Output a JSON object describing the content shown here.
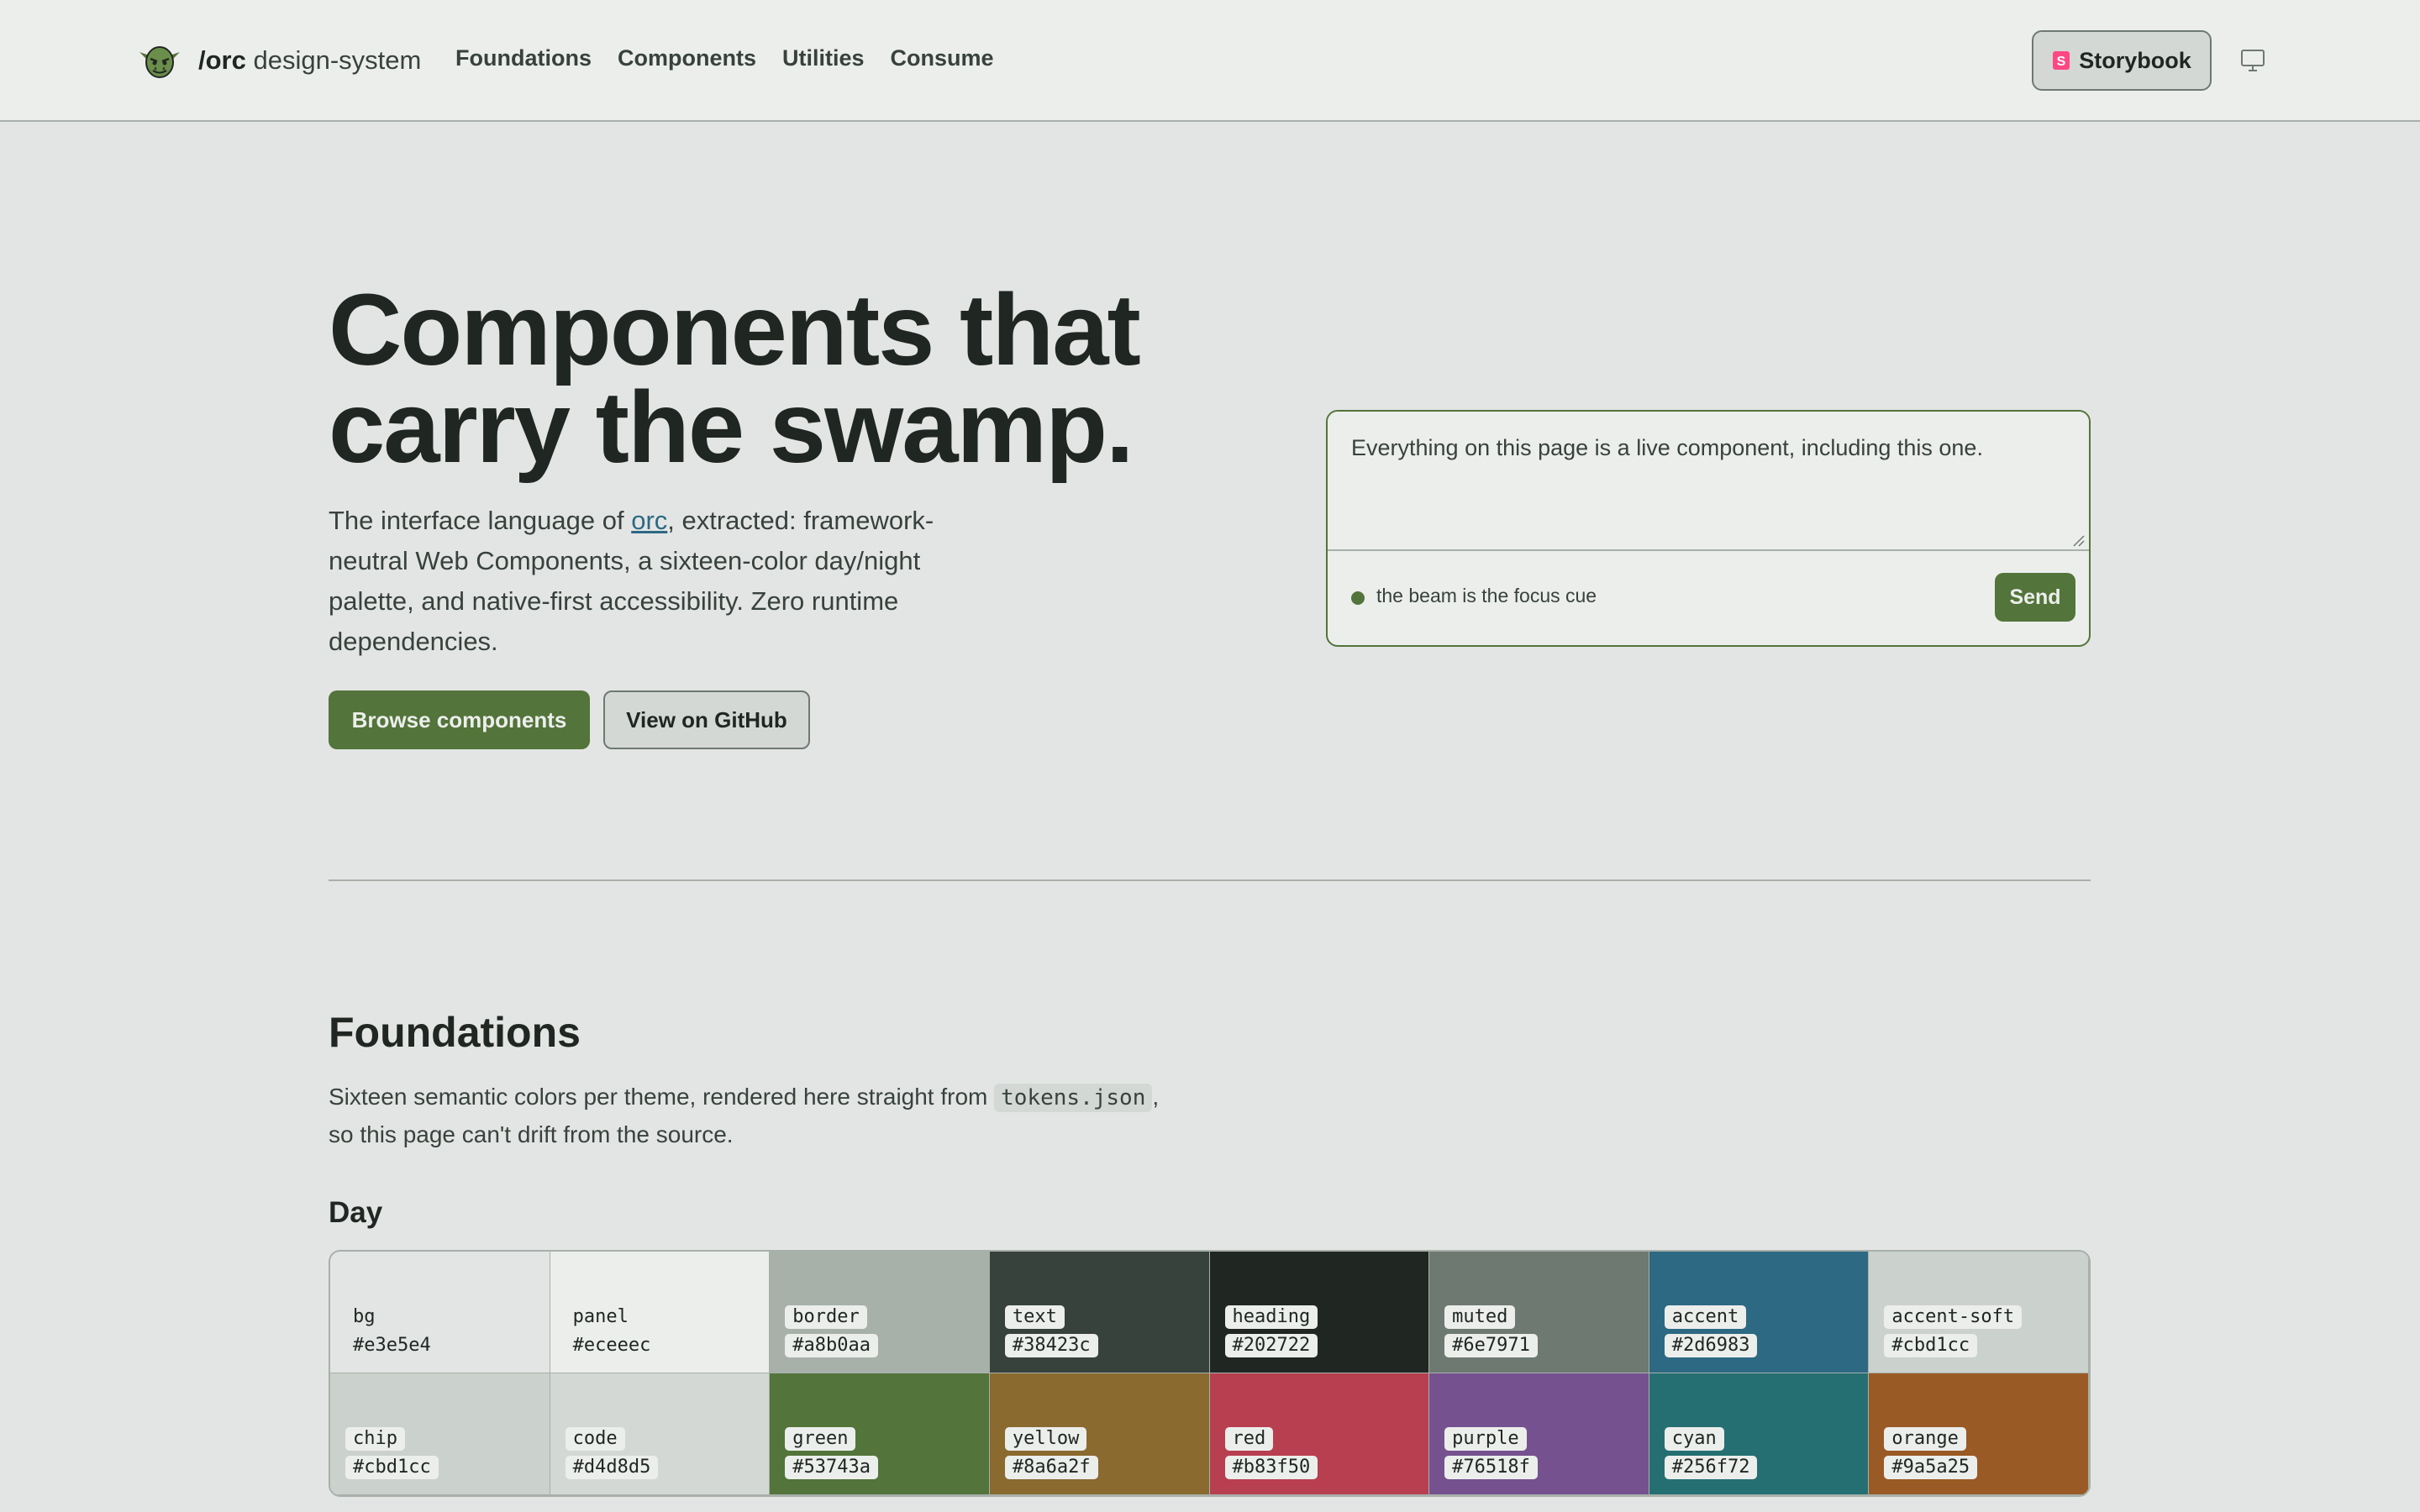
{
  "header": {
    "brand_prefix": "/orc",
    "brand_suffix": " design-system",
    "nav": [
      "Foundations",
      "Components",
      "Utilities",
      "Consume"
    ],
    "storybook_label": "Storybook",
    "storybook_icon": "storybook-icon",
    "theme_icon": "monitor-icon"
  },
  "hero": {
    "title_line1": "Components that",
    "title_line2": "carry the swamp.",
    "lede_before": "The interface language of ",
    "lede_link": "orc",
    "lede_after": ", extracted: framework-neutral Web Components, a sixteen-color day/night palette, and native-first accessibility. Zero runtime dependencies.",
    "primary_button": "Browse components",
    "secondary_button": "View on GitHub"
  },
  "composer": {
    "text": "Everything on this page is a live component, including this one.",
    "status": "the beam is the focus cue",
    "send_label": "Send"
  },
  "foundations": {
    "title": "Foundations",
    "lede_before": "Sixteen semantic colors per theme, rendered here straight from ",
    "lede_code": "tokens.json",
    "lede_after": ",",
    "lede_line2": "so this page can't drift from the source.",
    "day_title": "Day",
    "swatches": [
      {
        "name": "bg",
        "hex": "#e3e5e4",
        "tone": "light"
      },
      {
        "name": "panel",
        "hex": "#eceeec",
        "tone": "light"
      },
      {
        "name": "border",
        "hex": "#a8b0aa",
        "tone": "dark"
      },
      {
        "name": "text",
        "hex": "#38423c",
        "tone": "dark"
      },
      {
        "name": "heading",
        "hex": "#202722",
        "tone": "dark"
      },
      {
        "name": "muted",
        "hex": "#6e7971",
        "tone": "dark"
      },
      {
        "name": "accent",
        "hex": "#2d6983",
        "tone": "dark"
      },
      {
        "name": "accent-soft",
        "hex": "#cbd1cc",
        "tone": "dark"
      },
      {
        "name": "chip",
        "hex": "#cbd1cc",
        "tone": "dark"
      },
      {
        "name": "code",
        "hex": "#d4d8d5",
        "tone": "dark"
      },
      {
        "name": "green",
        "hex": "#53743a",
        "tone": "dark"
      },
      {
        "name": "yellow",
        "hex": "#8a6a2f",
        "tone": "dark"
      },
      {
        "name": "red",
        "hex": "#b83f50",
        "tone": "dark"
      },
      {
        "name": "purple",
        "hex": "#76518f",
        "tone": "dark"
      },
      {
        "name": "cyan",
        "hex": "#256f72",
        "tone": "dark"
      },
      {
        "name": "orange",
        "hex": "#9a5a25",
        "tone": "dark"
      }
    ]
  }
}
